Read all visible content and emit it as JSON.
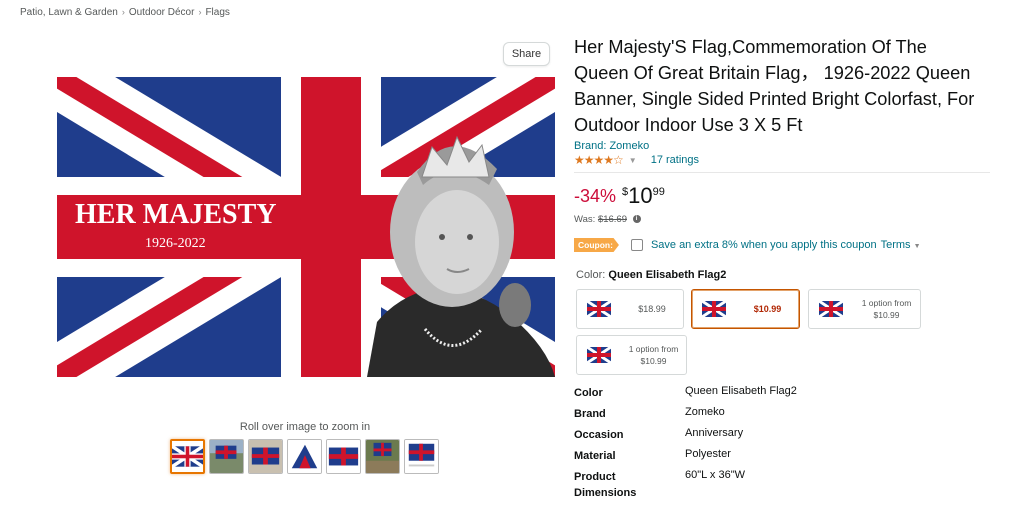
{
  "breadcrumb": [
    "Patio, Lawn & Garden",
    "Outdoor Décor",
    "Flags"
  ],
  "breadcrumb_separator": "›",
  "share_label": "Share",
  "image": {
    "banner_title": "HER MAJESTY",
    "banner_years": "1926-2022",
    "zoom_hint": "Roll over image to zoom in",
    "thumbnail_count": 7
  },
  "product": {
    "title": "Her Majesty'S Flag,Commemoration Of The Queen Of Great Britain Flag， 1926-2022 Queen Banner, Single Sided Printed Bright Colorfast, For Outdoor Indoor Use 3 X 5 Ft",
    "brand_line": "Brand: Zomeko",
    "rating_stars": 4.3,
    "ratings_text": "17 ratings"
  },
  "price": {
    "discount": "-34%",
    "currency": "$",
    "whole": "10",
    "fraction": "99",
    "was_label": "Was:",
    "was_price": "$16.69"
  },
  "coupon": {
    "badge": "Coupon:",
    "text": "Save an extra 8% when you apply this coupon",
    "terms": "Terms"
  },
  "color_option": {
    "label": "Color:",
    "value": "Queen Elisabeth Flag2"
  },
  "swatches": [
    {
      "line1": "$18.99",
      "line2": "",
      "selected": false
    },
    {
      "line1": "$10.99",
      "line2": "",
      "selected": true
    },
    {
      "line1": "1 option from",
      "line2": "$10.99",
      "selected": false
    },
    {
      "line1": "1 option from",
      "line2": "$10.99",
      "selected": false
    }
  ],
  "specs": [
    {
      "key": "Color",
      "value": "Queen Elisabeth Flag2"
    },
    {
      "key": "Brand",
      "value": "Zomeko"
    },
    {
      "key": "Occasion",
      "value": "Anniversary"
    },
    {
      "key": "Material",
      "value": "Polyester"
    },
    {
      "key": "Product Dimensions",
      "value": "60\"L x 36\"W"
    }
  ],
  "colors": {
    "link": "#007185",
    "discount": "#cc0c39",
    "star": "#de7921",
    "coupon_badge": "#f7a847",
    "selected_border": "#c45500",
    "flag_blue": "#1f3d8c",
    "flag_red": "#cf142b"
  }
}
